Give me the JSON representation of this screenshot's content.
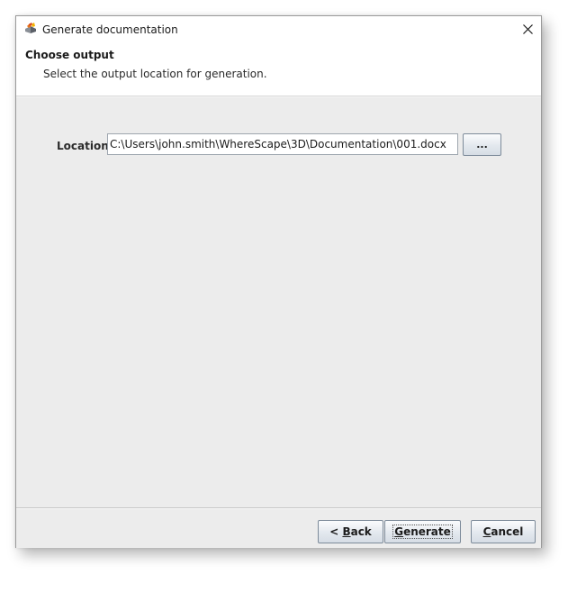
{
  "window": {
    "title": "Generate documentation",
    "close_icon": "close-icon",
    "app_icon": "wherescape-app-icon"
  },
  "header": {
    "title": "Choose output",
    "description": "Select the output location for generation."
  },
  "form": {
    "location_label": "Location:",
    "location_value": "C:\\Users\\john.smith\\WhereScape\\3D\\Documentation\\001.docx",
    "browse_label": "..."
  },
  "footer": {
    "back": {
      "prefix": "< ",
      "mnemonic": "B",
      "rest": "ack"
    },
    "generate": {
      "prefix": "",
      "mnemonic": "G",
      "rest": "enerate"
    },
    "cancel": {
      "prefix": "",
      "mnemonic": "C",
      "rest": "ancel"
    }
  },
  "colors": {
    "content_background": "#ececec",
    "header_background": "#ffffff",
    "button_border": "#7d8b9a"
  }
}
